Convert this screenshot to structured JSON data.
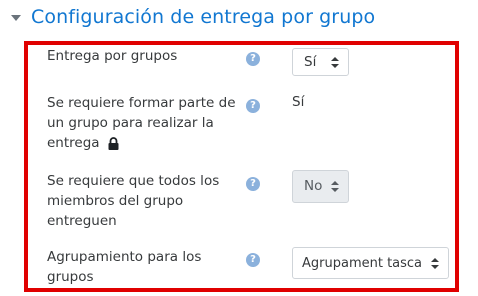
{
  "section": {
    "title": "Configuración de entrega por grupo",
    "caret_icon": "chevron-down-icon"
  },
  "settings": [
    {
      "label": "Entrega por grupos",
      "help_icon": "help-icon",
      "help_glyph": "?",
      "control": "select",
      "value": "Sí",
      "disabled": false
    },
    {
      "label_lines": [
        "Se requiere formar parte de",
        "un grupo para realizar la",
        "entrega"
      ],
      "lock_icon": "lock-icon",
      "help_icon": "help-icon",
      "help_glyph": "?",
      "control": "static",
      "value": "Sí"
    },
    {
      "label_lines": [
        "Se requiere que todos los",
        "miembros del grupo",
        "entreguen"
      ],
      "help_icon": "help-icon",
      "help_glyph": "?",
      "control": "select",
      "value": "No",
      "disabled": true
    },
    {
      "label_lines": [
        "Agrupamiento para los",
        "grupos"
      ],
      "help_icon": "help-icon",
      "help_glyph": "?",
      "control": "select",
      "value": "Agrupament tasca",
      "disabled": false
    }
  ],
  "colors": {
    "accent": "#1177d1",
    "highlight_frame": "#e00000",
    "help_icon": "#8bb1dc",
    "disabled_bg": "#e9ecef"
  }
}
